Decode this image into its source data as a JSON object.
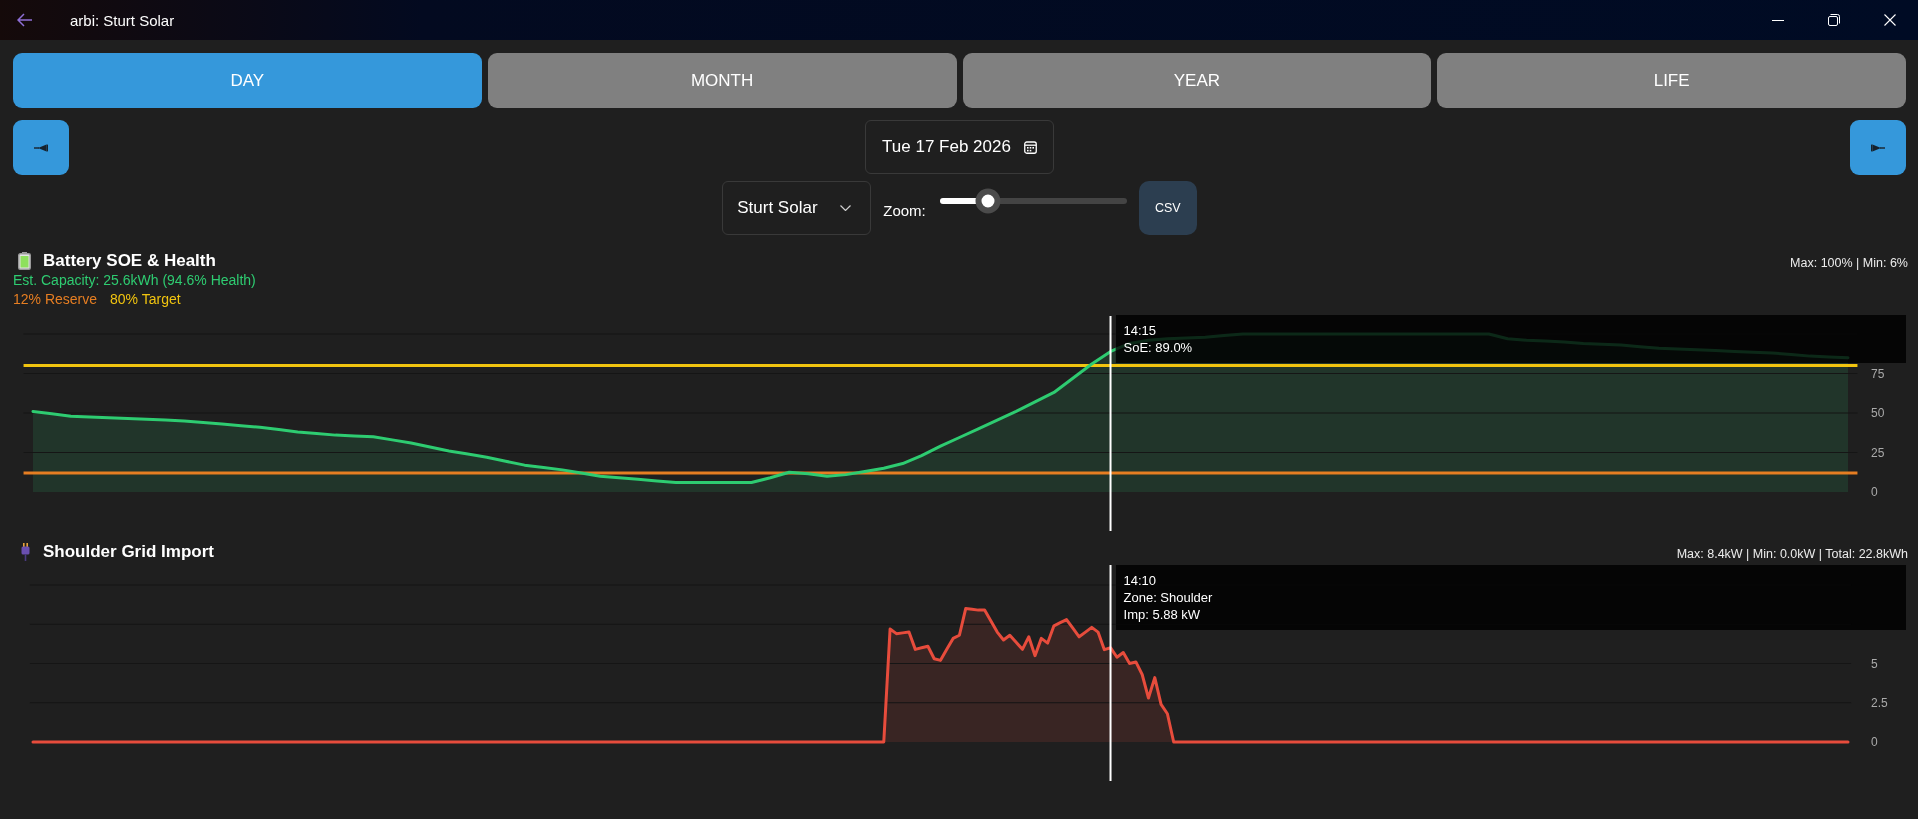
{
  "window": {
    "title": "arbi: Sturt Solar"
  },
  "tabs": [
    {
      "label": "DAY",
      "selected": true
    },
    {
      "label": "MONTH",
      "selected": false
    },
    {
      "label": "YEAR",
      "selected": false
    },
    {
      "label": "LIFE",
      "selected": false
    }
  ],
  "date_picker": {
    "value": "Tue 17 Feb 2026"
  },
  "site_select": {
    "value": "Sturt Solar"
  },
  "zoom": {
    "label": "Zoom:",
    "level": 0.26
  },
  "export_button": {
    "label": "CSV"
  },
  "battery_panel": {
    "title": "Battery SOE & Health",
    "capacity": "Est. Capacity: 25.6kWh (94.6% Health)",
    "legend": [
      {
        "label": "12% Reserve",
        "color": "#e67e22"
      },
      {
        "label": "80% Target",
        "color": "#f1c40f"
      }
    ],
    "stats": "Max: 100% | Min: 6%",
    "tooltip": {
      "level": 0.579,
      "lines": [
        "14:15",
        "SoE: 89.0%"
      ]
    },
    "chart_data": {
      "type": "area",
      "categories": [
        null,
        null,
        null,
        null,
        null,
        null,
        null,
        null,
        null,
        null,
        null,
        null,
        null,
        null,
        null,
        null,
        null,
        null,
        null,
        null,
        null,
        null,
        null,
        null,
        null,
        null,
        null,
        null,
        null,
        null,
        null,
        null,
        null,
        null,
        null,
        null,
        null,
        null,
        null,
        null,
        null,
        null,
        null,
        null,
        null,
        null,
        null,
        null,
        null,
        null,
        null,
        null,
        null,
        null,
        null,
        null,
        null,
        null,
        null,
        null,
        null,
        null,
        null,
        null,
        null,
        null,
        null,
        null,
        null,
        null,
        null,
        null,
        null,
        null,
        null,
        null,
        null,
        null,
        null,
        null,
        null,
        null,
        null,
        null,
        null,
        null,
        null,
        null,
        null,
        null,
        null,
        null,
        null,
        null,
        null,
        null,
        null
      ],
      "ylim": [
        0,
        100
      ],
      "yticks": [
        0,
        25,
        50,
        75
      ],
      "series": [
        {
          "color": "#2ecc71",
          "values": [
            51,
            49.5,
            48,
            47.5,
            47,
            46.5,
            46,
            45.5,
            45,
            44,
            43,
            42,
            41,
            39.5,
            38,
            37,
            36,
            35.5,
            35,
            33,
            31,
            28.5,
            26,
            24,
            22,
            19.5,
            17,
            15.5,
            14,
            12,
            10,
            9,
            8,
            7,
            6,
            6,
            6,
            6,
            6,
            9,
            12.5,
            11.5,
            10,
            11,
            13,
            15,
            18,
            23,
            29,
            34.5,
            40,
            45.5,
            51,
            57,
            63,
            72,
            81,
            89,
            94,
            96,
            97,
            97.5,
            98,
            99,
            100,
            100,
            100,
            100,
            100,
            100,
            100,
            100,
            100,
            100,
            100,
            100,
            100,
            100,
            97,
            96,
            95.5,
            95,
            94,
            93.5,
            93,
            92,
            91,
            90.5,
            90,
            89.5,
            89,
            88.5,
            88,
            87,
            86,
            85.5,
            85
          ]
        }
      ],
      "ref_lines": [
        {
          "axis": "y",
          "value": 12
        },
        {
          "axis": "y",
          "value": 80
        }
      ]
    }
  },
  "grid_import_panel": {
    "title": "Shoulder Grid Import",
    "stats": "Max: 8.4kW | Min: 0.0kW | Total: 22.8kWh",
    "tooltip": {
      "level": 0.579,
      "lines": [
        "14:10",
        "Zone: Shoulder",
        "Imp: 5.88 kW"
      ]
    },
    "chart_data": {
      "type": "area",
      "categories": [
        null,
        null,
        null,
        null,
        null,
        null,
        null,
        null,
        null,
        null,
        null,
        null,
        null,
        null,
        null,
        null,
        null,
        null,
        null,
        null,
        null,
        null,
        null,
        null,
        null,
        null,
        null,
        null,
        null,
        null,
        null,
        null,
        null,
        null,
        null,
        null,
        null,
        null,
        null,
        null,
        null,
        null,
        null,
        null,
        null,
        null,
        null,
        null,
        null,
        null,
        null,
        null,
        null,
        null,
        null,
        null,
        null,
        null,
        null,
        null,
        null,
        null,
        null,
        null,
        null,
        null,
        null,
        null,
        null,
        null,
        null,
        null,
        null,
        null,
        null,
        null,
        null,
        null,
        null,
        null,
        null,
        null,
        null,
        null,
        null,
        null,
        null,
        null,
        null,
        null,
        null,
        null,
        null,
        null,
        null,
        null,
        null,
        null,
        null,
        null,
        null,
        null,
        null,
        null,
        null,
        null,
        null,
        null,
        null,
        null,
        null,
        null,
        null,
        null,
        null,
        null,
        null,
        null,
        null,
        null,
        null,
        null,
        null,
        null,
        null,
        null,
        null,
        null,
        null,
        null,
        null,
        null,
        null,
        null,
        null,
        null,
        null,
        null,
        null,
        null,
        null,
        null,
        null,
        null,
        null,
        null,
        null,
        null,
        null,
        null,
        null,
        null,
        null,
        null,
        null,
        null,
        null,
        null,
        null,
        null,
        null,
        null,
        null,
        null,
        null,
        null,
        null,
        null,
        null,
        null,
        null,
        null,
        null,
        null,
        null,
        null,
        null,
        null,
        null,
        null,
        null,
        null,
        null,
        null,
        null,
        null,
        null,
        null,
        null,
        null,
        null,
        null,
        null,
        null,
        null,
        null,
        null,
        null,
        null,
        null,
        null,
        null,
        null,
        null,
        null,
        null,
        null,
        null,
        null,
        null,
        null,
        null,
        null,
        null,
        null,
        null,
        null,
        null,
        null,
        null,
        null,
        null,
        null,
        null,
        null,
        null,
        null,
        null,
        null,
        null,
        null,
        null,
        null,
        null,
        null,
        null,
        null,
        null,
        null,
        null,
        null,
        null,
        null,
        null,
        null,
        null,
        null,
        null,
        null,
        null,
        null,
        null,
        null,
        null,
        null,
        null,
        null,
        null,
        null,
        null,
        null,
        null,
        null,
        null,
        null,
        null,
        null,
        null,
        null,
        null,
        null,
        null,
        null,
        null,
        null,
        null,
        null,
        null,
        null,
        null,
        null,
        null,
        null,
        null,
        null,
        null,
        null,
        null,
        null
      ],
      "ylim": [
        0,
        10
      ],
      "yticks": [
        0,
        2.5,
        5
      ],
      "series": [
        {
          "color": "#e74c3c",
          "values": [
            0,
            0,
            0,
            0,
            0,
            0,
            0,
            0,
            0,
            0,
            0,
            0,
            0,
            0,
            0,
            0,
            0,
            0,
            0,
            0,
            0,
            0,
            0,
            0,
            0,
            0,
            0,
            0,
            0,
            0,
            0,
            0,
            0,
            0,
            0,
            0,
            0,
            0,
            0,
            0,
            0,
            0,
            0,
            0,
            0,
            0,
            0,
            0,
            0,
            0,
            0,
            0,
            0,
            0,
            0,
            0,
            0,
            0,
            0,
            0,
            0,
            0,
            0,
            0,
            0,
            0,
            0,
            0,
            0,
            0,
            0,
            0,
            0,
            0,
            0,
            0,
            0,
            0,
            0,
            0,
            0,
            0,
            0,
            0,
            0,
            0,
            0,
            0,
            0,
            0,
            0,
            0,
            0,
            0,
            0,
            0,
            0,
            0,
            0,
            0,
            0,
            0,
            0,
            0,
            0,
            0,
            0,
            0,
            0,
            0,
            0,
            0,
            0,
            0,
            0,
            0,
            0,
            0,
            0,
            0,
            0,
            0,
            0,
            0,
            0,
            0,
            0,
            0,
            0,
            0,
            0,
            0,
            0,
            0,
            0,
            0,
            7.2,
            6.9,
            6.95,
            7.0,
            5.9,
            6.0,
            6.1,
            5.3,
            5.2,
            5.9,
            6.6,
            6.8,
            8.5,
            8.45,
            8.4,
            8.4,
            7.7,
            7.0,
            6.5,
            6.8,
            6.35,
            5.9,
            6.7,
            5.5,
            6.6,
            6.3,
            7.4,
            7.6,
            7.8,
            7.25,
            6.7,
            7.0,
            7.3,
            7.0,
            5.88,
            6.0,
            5.4,
            5.7,
            5.0,
            5.1,
            4.3,
            2.8,
            4.1,
            2.4,
            1.8,
            0,
            0,
            0,
            0,
            0,
            0,
            0,
            0,
            0,
            0,
            0,
            0,
            0,
            0,
            0,
            0,
            0,
            0,
            0,
            0,
            0,
            0,
            0,
            0,
            0,
            0,
            0,
            0,
            0,
            0,
            0,
            0,
            0,
            0,
            0,
            0,
            0,
            0,
            0,
            0,
            0,
            0,
            0,
            0,
            0,
            0,
            0,
            0,
            0,
            0,
            0,
            0,
            0,
            0,
            0,
            0,
            0,
            0,
            0,
            0,
            0,
            0,
            0,
            0,
            0,
            0,
            0,
            0,
            0,
            0,
            0,
            0,
            0,
            0,
            0,
            0,
            0,
            0,
            0,
            0,
            0,
            0,
            0,
            0,
            0,
            0,
            0,
            0,
            0,
            0,
            0,
            0,
            0,
            0,
            0,
            0,
            0,
            0,
            0,
            0,
            0,
            0,
            0,
            0,
            0,
            0,
            0,
            0
          ]
        }
      ]
    }
  }
}
